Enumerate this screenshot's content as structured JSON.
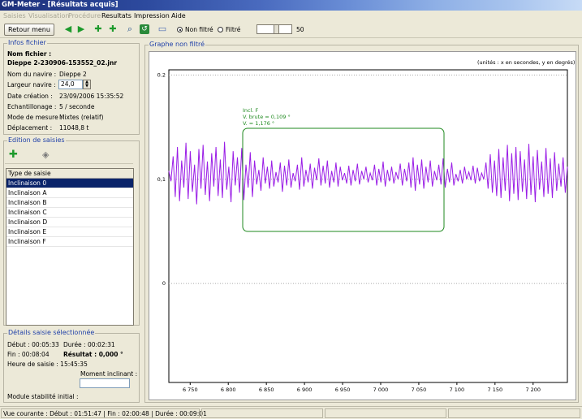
{
  "window": {
    "title": "GM-Meter - [Résultats acquis]"
  },
  "menu": [
    "Saisies",
    "Visualisation",
    "Procédure",
    "Resultats",
    "Impression",
    "Aide"
  ],
  "toolbar": {
    "back_label": "Retour menu",
    "radio_unfiltered": "Non filtré",
    "radio_filtered": "Filtré",
    "radio_selected": "Non filtré",
    "slider_value": "50",
    "icons": [
      "arrow-left-icon",
      "arrow-right-icon",
      "add-marker-icon",
      "add-marker-2-icon",
      "zoom-icon",
      "refresh-icon",
      "note-icon"
    ]
  },
  "file_info": {
    "title": "Infos fichier",
    "name_label": "Nom fichier :",
    "name_value": "Dieppe 2-230906-153552_02.jnr",
    "ship_label": "Nom du navire :",
    "ship_value": "Dieppe 2",
    "width_label": "Largeur navire :",
    "width_value": "24,0",
    "date_label": "Date création :",
    "date_value": "23/09/2006 15:35:52",
    "sampling_label": "Echantillonage :",
    "sampling_value": "5 / seconde",
    "mode_label": "Mode de mesure :",
    "mode_value": "Mixtes (relatif)",
    "disp_label": "Déplacement :",
    "disp_value": "11048,8 t"
  },
  "edit": {
    "title": "Edition de saisies",
    "list_header": "Type de saisie",
    "items": [
      "Inclinaison 0",
      "Inclinaison A",
      "Inclinaison B",
      "Inclinaison C",
      "Inclinaison D",
      "Inclinaison E",
      "Inclinaison F"
    ],
    "selected_index": 0
  },
  "details": {
    "title": "Détails saisie sélectionnée",
    "start": "Début : 00:05:33",
    "duration": "Durée : 00:02:31",
    "end": "Fin :     00:08:04",
    "result": "Résultat : 0,000 °",
    "time": "Heure de saisie :  15:45:35",
    "moment_label": "Moment inclinant :",
    "moment_value": "",
    "stability_label": "Module stabilité initial :"
  },
  "graph": {
    "title": "Graphe non filtré",
    "units_note": "(unités : x en secondes, y en degrés)",
    "annotation": [
      "Incl. F",
      "V. brute = 0,109 °",
      "V. = 1,176 °"
    ],
    "line_color": "#9a1de6",
    "box_color": "#1f8a1f"
  },
  "chart_data": {
    "type": "line",
    "title": "",
    "xlabel": "",
    "ylabel": "",
    "xlim": [
      6722,
      7245
    ],
    "ylim": [
      -0.095,
      0.205
    ],
    "x_ticks": [
      6750,
      6800,
      6850,
      6900,
      6950,
      7000,
      7050,
      7100,
      7150,
      7200
    ],
    "x_tick_labels": [
      "6 750",
      "6 800",
      "6 850",
      "6 900",
      "6 950",
      "7 000",
      "7 050",
      "7 100",
      "7 150",
      "7 200"
    ],
    "y_ticks": [
      0,
      0.1,
      0.2
    ],
    "y_tick_labels": [
      "0",
      "0,1",
      "0.2"
    ],
    "grid": "horizontal-dotted",
    "series": [
      {
        "x_start": 6722,
        "x_end": 7245,
        "values": [
          0.108,
          0.098,
          0.122,
          0.083,
          0.131,
          0.079,
          0.118,
          0.092,
          0.135,
          0.081,
          0.127,
          0.088,
          0.114,
          0.076,
          0.129,
          0.091,
          0.133,
          0.085,
          0.117,
          0.079,
          0.125,
          0.093,
          0.131,
          0.084,
          0.119,
          0.082,
          0.136,
          0.09,
          0.112,
          0.078,
          0.127,
          0.094,
          0.121,
          0.087,
          0.13,
          0.08,
          0.114,
          0.092,
          0.126,
          0.083,
          0.118,
          0.095,
          0.109,
          0.089,
          0.121,
          0.096,
          0.112,
          0.091,
          0.118,
          0.093,
          0.107,
          0.097,
          0.116,
          0.088,
          0.113,
          0.094,
          0.119,
          0.092,
          0.106,
          0.098,
          0.114,
          0.09,
          0.121,
          0.093,
          0.109,
          0.097,
          0.115,
          0.091,
          0.111,
          0.099,
          0.12,
          0.094,
          0.113,
          0.096,
          0.118,
          0.092,
          0.108,
          0.097,
          0.116,
          0.093,
          0.112,
          0.099,
          0.106,
          0.096,
          0.113,
          0.094,
          0.109,
          0.098,
          0.115,
          0.095,
          0.108,
          0.1,
          0.112,
          0.097,
          0.106,
          0.099,
          0.114,
          0.094,
          0.11,
          0.097,
          0.117,
          0.093,
          0.109,
          0.098,
          0.112,
          0.096,
          0.107,
          0.1,
          0.115,
          0.094,
          0.11,
          0.098,
          0.116,
          0.092,
          0.121,
          0.089,
          0.114,
          0.095,
          0.119,
          0.091,
          0.112,
          0.097,
          0.118,
          0.093,
          0.108,
          0.099,
          0.114,
          0.095,
          0.12,
          0.092,
          0.11,
          0.097,
          0.116,
          0.094,
          0.105,
          0.098,
          0.109,
          0.096,
          0.112,
          0.1,
          0.107,
          0.099,
          0.113,
          0.096,
          0.111,
          0.098,
          0.106,
          0.1,
          0.116,
          0.091,
          0.124,
          0.087,
          0.118,
          0.084,
          0.129,
          0.082,
          0.121,
          0.089,
          0.133,
          0.079,
          0.125,
          0.086,
          0.131,
          0.08,
          0.127,
          0.088,
          0.119,
          0.081,
          0.134,
          0.085,
          0.122,
          0.078,
          0.128,
          0.09,
          0.117,
          0.083,
          0.13,
          0.086,
          0.12,
          0.082,
          0.126,
          0.089,
          0.115,
          0.093,
          0.121,
          0.087,
          0.112
        ]
      }
    ]
  }
}
